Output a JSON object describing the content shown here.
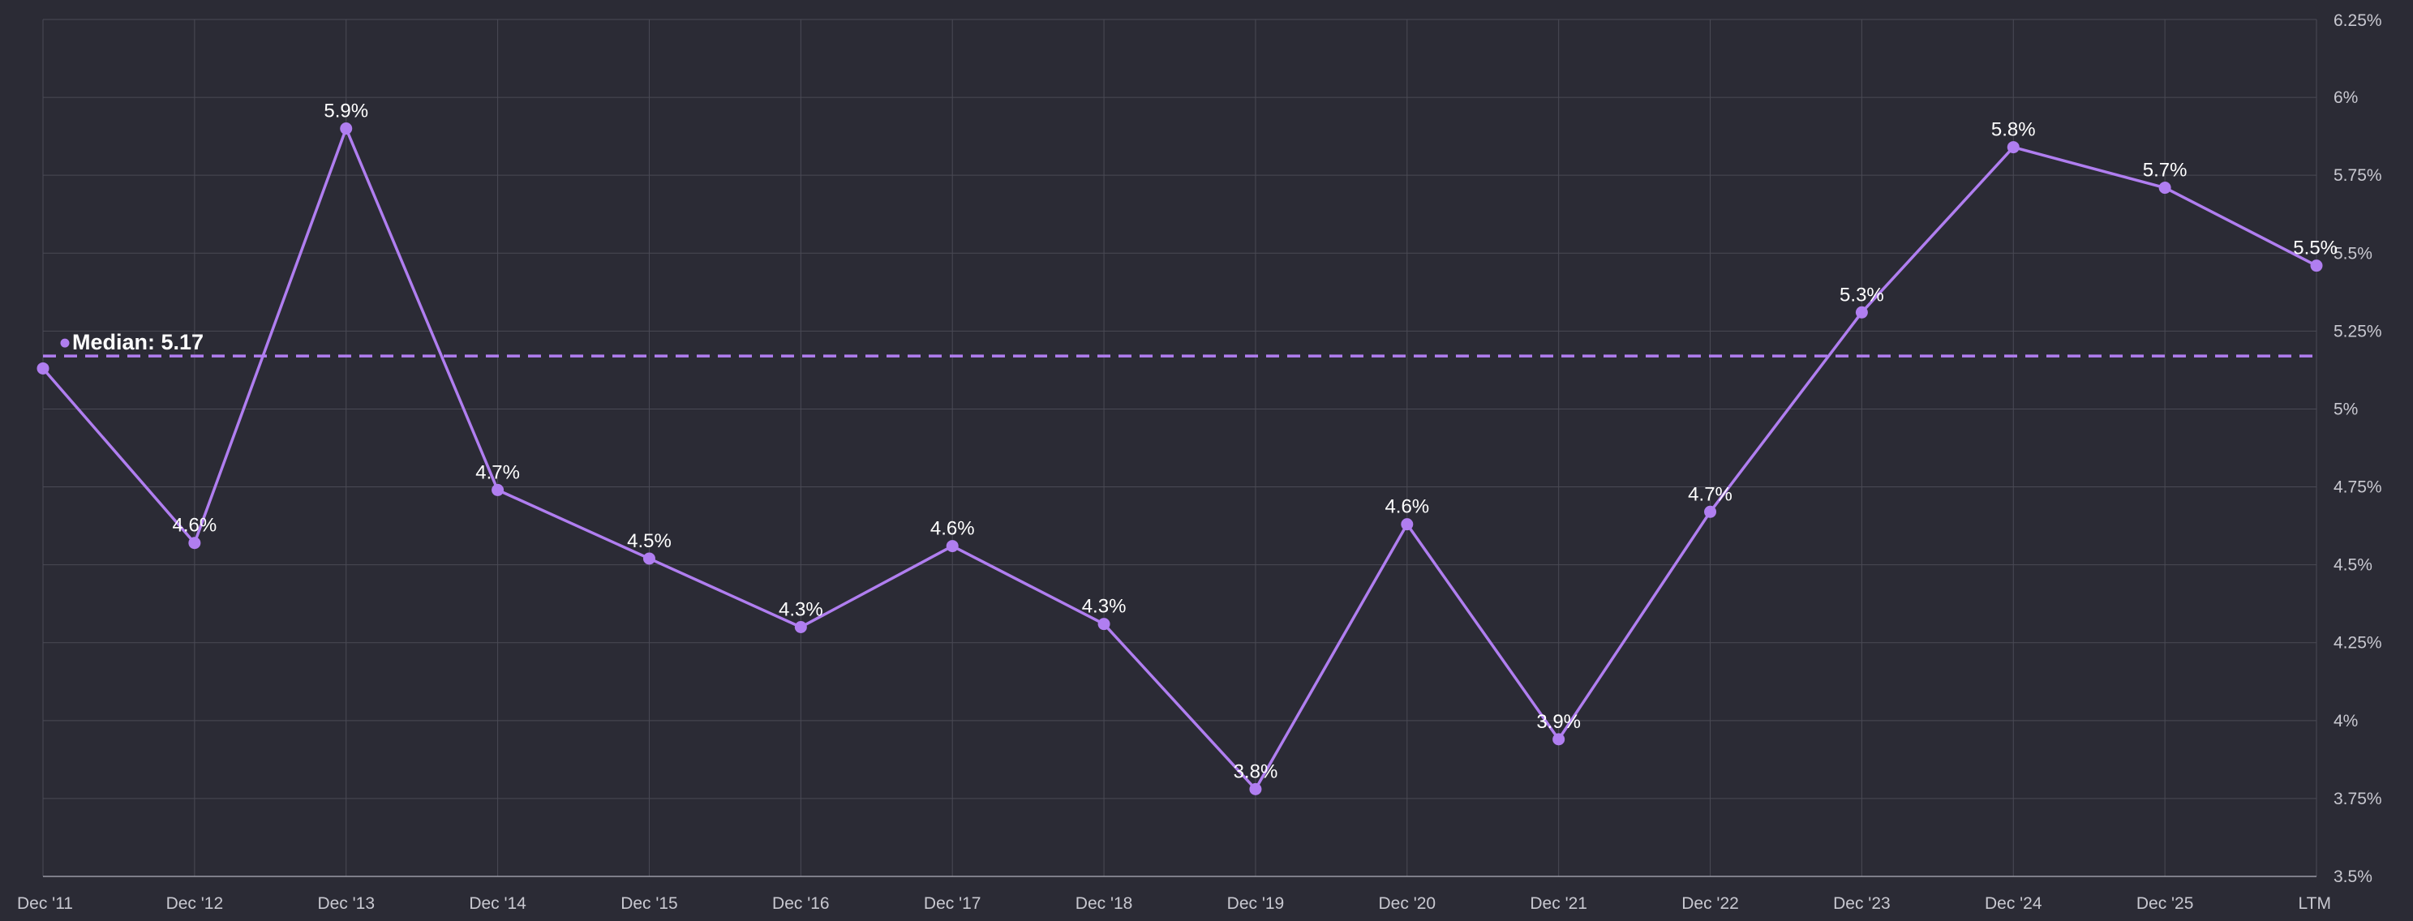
{
  "chart_data": {
    "type": "line",
    "categories": [
      "Dec '11",
      "Dec '12",
      "Dec '13",
      "Dec '14",
      "Dec '15",
      "Dec '16",
      "Dec '17",
      "Dec '18",
      "Dec '19",
      "Dec '20",
      "Dec '21",
      "Dec '22",
      "Dec '23",
      "Dec '24",
      "Dec '25",
      "LTM"
    ],
    "series": [
      {
        "values": [
          5.13,
          4.57,
          5.9,
          4.74,
          4.52,
          4.3,
          4.56,
          4.31,
          3.78,
          4.63,
          3.94,
          4.67,
          5.31,
          5.84,
          5.71,
          5.46
        ],
        "data_labels": [
          null,
          "4.6%",
          "5.9%",
          "4.7%",
          "4.5%",
          "4.3%",
          "4.6%",
          "4.3%",
          "3.8%",
          "4.6%",
          "3.9%",
          "4.7%",
          "5.3%",
          "5.8%",
          "5.7%",
          "5.5%"
        ]
      }
    ],
    "median": {
      "value": 5.17,
      "label": "Median: 5.17"
    },
    "ylim": [
      3.5,
      6.25
    ],
    "y_ticks": [
      3.5,
      3.75,
      4,
      4.25,
      4.5,
      4.75,
      5,
      5.25,
      5.5,
      5.75,
      6,
      6.25
    ],
    "y_tick_labels": [
      "3.5%",
      "3.75%",
      "4%",
      "4.25%",
      "4.5%",
      "4.75%",
      "5%",
      "5.25%",
      "5.5%",
      "5.75%",
      "6%",
      "6.25%"
    ],
    "y_axis_side": "right",
    "grid": true,
    "colors": {
      "background": "#2b2b35",
      "series": "#b07ef0",
      "grid": "#4a4a55",
      "text": "#ffffff",
      "tick_text": "#c8c8d0"
    }
  }
}
